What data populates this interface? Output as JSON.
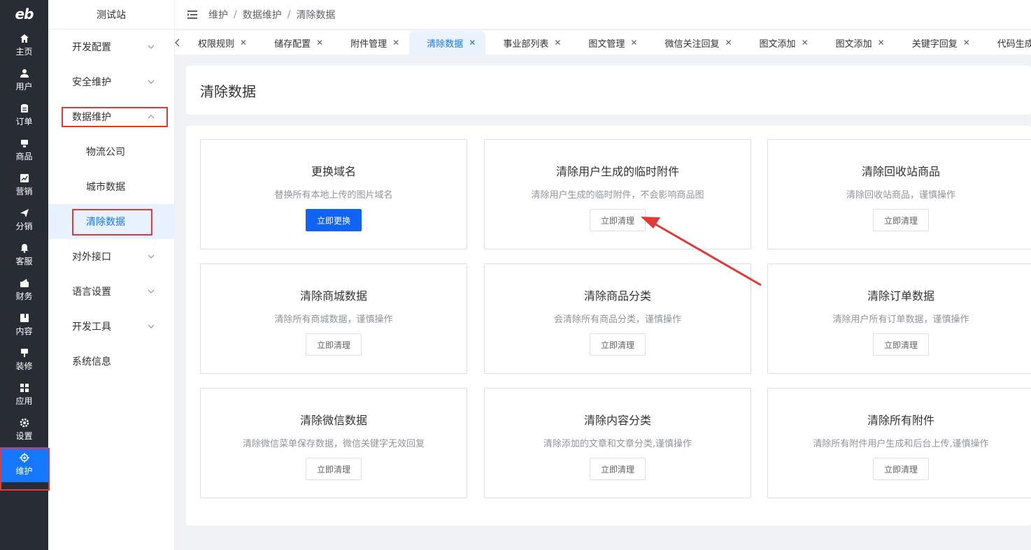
{
  "rail": {
    "logo": "eb",
    "items": [
      {
        "label": "主页",
        "icon": "home-icon"
      },
      {
        "label": "用户",
        "icon": "user-icon"
      },
      {
        "label": "订单",
        "icon": "order-icon"
      },
      {
        "label": "商品",
        "icon": "product-icon"
      },
      {
        "label": "营销",
        "icon": "marketing-icon"
      },
      {
        "label": "分销",
        "icon": "distribution-icon"
      },
      {
        "label": "客服",
        "icon": "bell-icon"
      },
      {
        "label": "财务",
        "icon": "finance-icon"
      },
      {
        "label": "内容",
        "icon": "content-icon"
      },
      {
        "label": "装修",
        "icon": "decoration-icon"
      },
      {
        "label": "应用",
        "icon": "apps-icon"
      },
      {
        "label": "设置",
        "icon": "gear-icon"
      },
      {
        "label": "维护",
        "icon": "chip-icon"
      }
    ]
  },
  "submenu": {
    "title": "测试站",
    "items": [
      "开发配置",
      "安全维护",
      "数据维护"
    ],
    "children": [
      "物流公司",
      "城市数据",
      "清除数据"
    ],
    "items_after": [
      "对外接口",
      "语言设置",
      "开发工具",
      "系统信息"
    ]
  },
  "breadcrumb": [
    "维护",
    "数据维护",
    "清除数据"
  ],
  "tabs": [
    "权限规则",
    "储存配置",
    "附件管理",
    "清除数据",
    "事业部列表",
    "图文管理",
    "微信关注回复",
    "图文添加",
    "图文添加",
    "关键字回复",
    "代码生成列表"
  ],
  "page_title": "清除数据",
  "cards": [
    {
      "title": "更换域名",
      "desc": "替换所有本地上传的图片域名",
      "btn": "立即更换"
    },
    {
      "title": "清除用户生成的临时附件",
      "desc": "清除用户生成的临时附件，不会影响商品图",
      "btn": "立即清理"
    },
    {
      "title": "清除回收站商品",
      "desc": "清除回收站商品，谨慎操作",
      "btn": "立即清理"
    },
    {
      "title": "清除商城数据",
      "desc": "清除所有商城数据，谨慎操作",
      "btn": "立即清理"
    },
    {
      "title": "清除商品分类",
      "desc": "会清除所有商品分类，谨慎操作",
      "btn": "立即清理"
    },
    {
      "title": "清除订单数据",
      "desc": "清除用户所有订单数据，谨慎操作",
      "btn": "立即清理"
    },
    {
      "title": "清除微信数据",
      "desc": "清除微信菜单保存数据，微信关键字无效回复",
      "btn": "立即清理"
    },
    {
      "title": "清除内容分类",
      "desc": "清除添加的文章和文章分类,谨慎操作",
      "btn": "立即清理"
    },
    {
      "title": "清除所有附件",
      "desc": "清除所有附件用户生成和后台上传,谨慎操作",
      "btn": "立即清理"
    }
  ],
  "colors": {
    "accent": "#1677ff",
    "primary_button": "#1163f4",
    "rail_bg": "#282c34",
    "annotation": "#e53935"
  }
}
